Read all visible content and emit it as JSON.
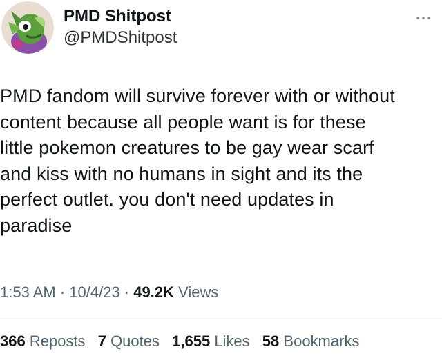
{
  "author": {
    "display_name": "PMD Shitpost",
    "handle": "@PMDShitpost",
    "avatar_icon": "pokemon-avatar-icon"
  },
  "more_icon": "more-dots-icon",
  "tweet": {
    "text": "PMD fandom will survive forever with or without\ncontent because all people want is for these\nlittle pokemon creatures to be gay wear scarf\nand kiss with no humans in sight and its the\nperfect outlet. you don't need updates in\nparadise"
  },
  "meta": {
    "time": "1:53 AM",
    "sep1": " · ",
    "date": "10/4/23",
    "sep2": " · ",
    "views_count": "49.2K",
    "views_label": " Views"
  },
  "stats": {
    "reposts_count": "366",
    "reposts_label": "Reposts",
    "quotes_count": "7",
    "quotes_label": "Quotes",
    "likes_count": "1,655",
    "likes_label": "Likes",
    "bookmarks_count": "58",
    "bookmarks_label": "Bookmarks"
  },
  "colors": {
    "text": "#0f1419",
    "secondary": "#536471",
    "divider": "#eff3f4"
  }
}
